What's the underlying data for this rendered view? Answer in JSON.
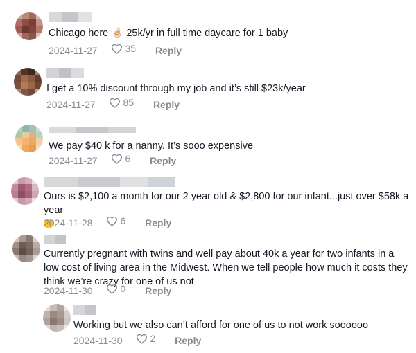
{
  "comments": [
    {
      "text": "Chicago here 🤞🏻 25k/yr in full time daycare for 1 baby",
      "date": "2024-11-27",
      "likes": "35",
      "reply": "Reply"
    },
    {
      "text": "I get a 10% discount through my job and it’s still $23k/year",
      "date": "2024-11-27",
      "likes": "85",
      "reply": "Reply"
    },
    {
      "text": "We pay $40 k for a nanny. It’s sooo expensive",
      "date": "2024-11-27",
      "likes": "6",
      "reply": "Reply"
    },
    {
      "text": "Ours is $2,100 a month for our 2 year old & $2,800 for our infant...just over $58k a year",
      "date": "2024-11-28",
      "likes": "6",
      "reply": "Reply"
    },
    {
      "text": "Currently pregnant with twins and well pay about 40k a year for two infants in a low cost of living area in the Midwest. When we tell people how much it costs they think we’re crazy for one of us not",
      "date": "2024-11-30",
      "likes": "0",
      "reply": "Reply"
    },
    {
      "text": "Working but we also can’t afford for one of us to not work soooooo",
      "date": "2024-11-30",
      "likes": "2",
      "reply": "Reply"
    }
  ],
  "colors": {
    "meta": "#8a8b91",
    "text": "#161823"
  },
  "icons": {
    "like": "heart-outline-icon",
    "avatar": "blurred-avatar"
  }
}
